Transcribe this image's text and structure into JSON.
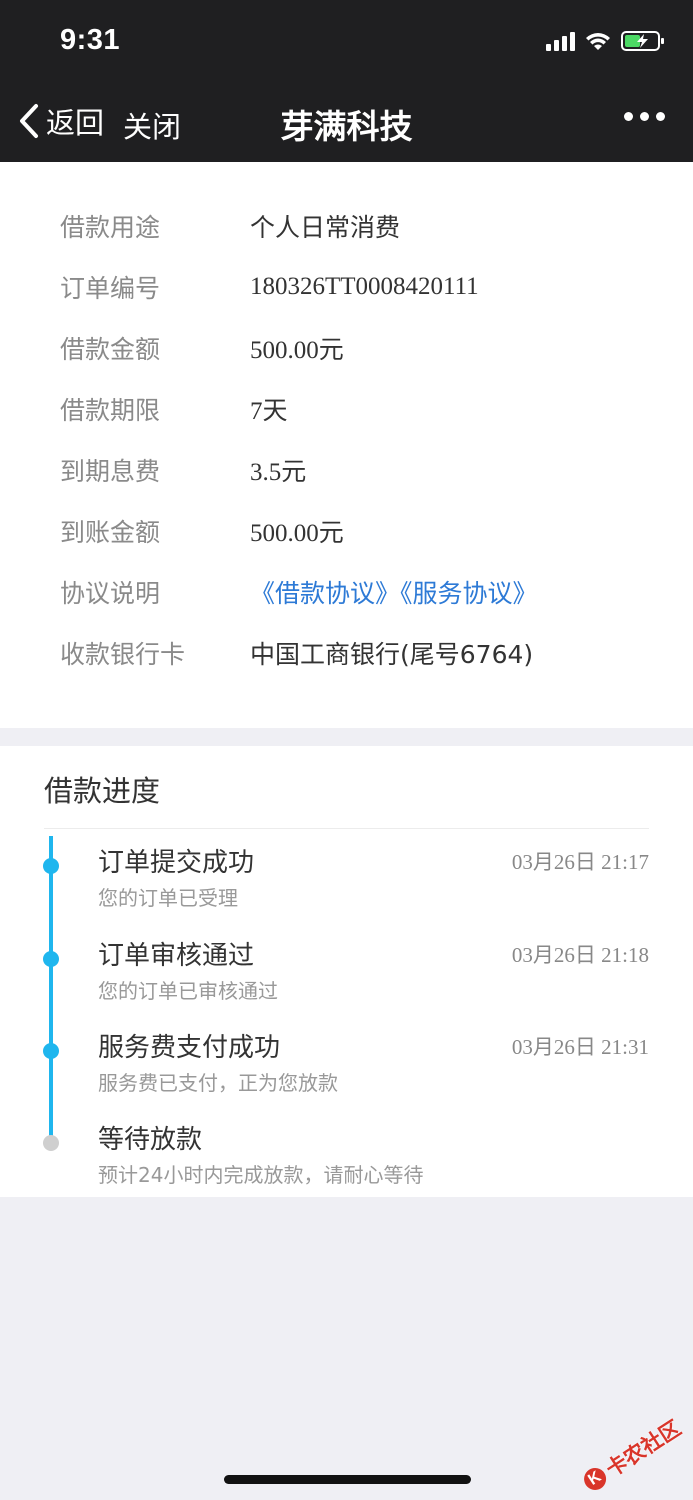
{
  "status": {
    "time": "9:31",
    "signal_icon": "signal-bars-icon",
    "wifi_icon": "wifi-icon",
    "battery_icon": "battery-charging-icon",
    "battery_color": "#4cd964"
  },
  "nav": {
    "back_label": "返回",
    "close_label": "关闭",
    "title": "芽满科技",
    "more_icon": "more-dots-icon",
    "bg_color": "#1f1f21"
  },
  "details": {
    "rows": [
      {
        "label": "借款用途",
        "value": "个人日常消费"
      },
      {
        "label": "订单编号",
        "value": "180326TT0008420111"
      },
      {
        "label": "借款金额",
        "value": "500.00元"
      },
      {
        "label": "借款期限",
        "value": "7天"
      },
      {
        "label": "到期息费",
        "value": "3.5元"
      },
      {
        "label": "到账金额",
        "value": "500.00元"
      },
      {
        "label": "协议说明",
        "links": [
          "《借款协议》",
          "《服务协议》"
        ]
      },
      {
        "label": "收款银行卡",
        "value": "中国工商银行(尾号6764)"
      }
    ],
    "link_color": "#2d7ad6"
  },
  "progress": {
    "title": "借款进度",
    "accent_color": "#1fb6ee",
    "steps": [
      {
        "title": "订单提交成功",
        "desc": "您的订单已受理",
        "time": "03月26日 21:17",
        "done": true
      },
      {
        "title": "订单审核通过",
        "desc": "您的订单已审核通过",
        "time": "03月26日 21:18",
        "done": true
      },
      {
        "title": "服务费支付成功",
        "desc": "服务费已支付，正为您放款",
        "time": "03月26日 21:31",
        "done": true
      },
      {
        "title": "等待放款",
        "desc": "预计24小时内完成放款，请耐心等待",
        "time": "",
        "done": false
      }
    ]
  },
  "watermark": {
    "text": "卡农社区",
    "mark": "K",
    "color": "#d9352a"
  }
}
